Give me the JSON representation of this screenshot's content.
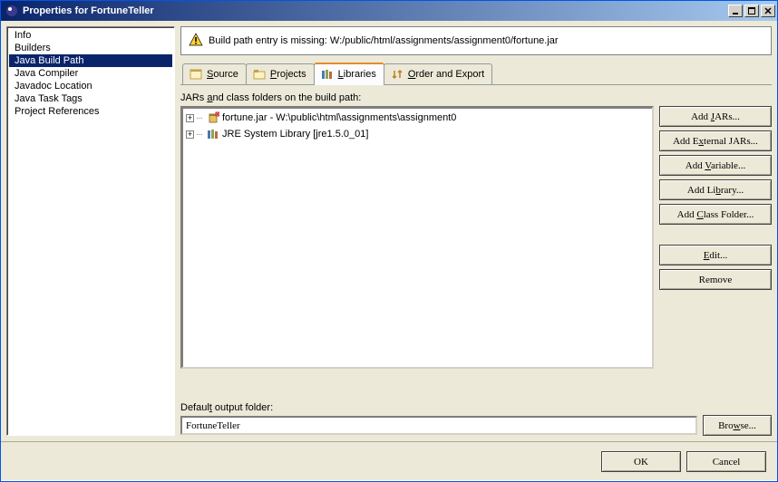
{
  "title": "Properties for FortuneTeller",
  "sidebar": {
    "items": [
      {
        "label": "Info"
      },
      {
        "label": "Builders"
      },
      {
        "label": "Java Build Path",
        "selected": true
      },
      {
        "label": "Java Compiler"
      },
      {
        "label": "Javadoc Location"
      },
      {
        "label": "Java Task Tags"
      },
      {
        "label": "Project References"
      }
    ]
  },
  "warning": "Build path entry is missing: W:/public/html/assignments/assignment0/fortune.jar",
  "tabs": [
    {
      "label": "Source",
      "icon": "source"
    },
    {
      "label": "Projects",
      "icon": "projects"
    },
    {
      "label": "Libraries",
      "icon": "libraries",
      "active": true
    },
    {
      "label": "Order and Export",
      "icon": "order"
    }
  ],
  "listLabel": "JARs and class folders on the build path:",
  "tree": [
    {
      "icon": "jar",
      "label": "fortune.jar - W:\\public\\html\\assignments\\assignment0"
    },
    {
      "icon": "lib",
      "label": "JRE System Library [jre1.5.0_01]"
    }
  ],
  "buttons": {
    "addJars": "Add JARs...",
    "addExternal": "Add External JARs...",
    "addVariable": "Add Variable...",
    "addLibrary": "Add Library...",
    "addClassFolder": "Add Class Folder...",
    "edit": "Edit...",
    "remove": "Remove"
  },
  "outputLabel": "Default output folder:",
  "outputValue": "FortuneTeller",
  "browse": "Browse...",
  "ok": "OK",
  "cancel": "Cancel"
}
